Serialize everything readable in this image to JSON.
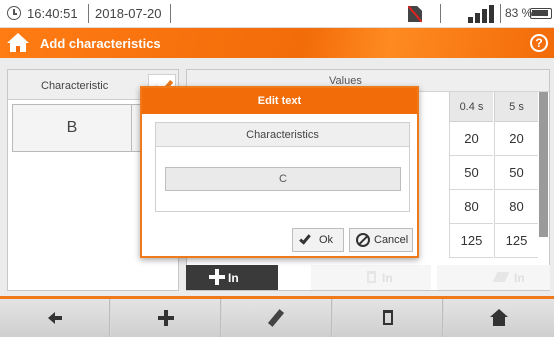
{
  "statusbar": {
    "time": "16:40:51",
    "date": "2018-07-20",
    "battery": "83 %"
  },
  "header": {
    "title": "Add characteristics"
  },
  "left_panel": {
    "header": "Characteristic",
    "items": [
      "B"
    ]
  },
  "right_panel": {
    "header": "Values",
    "columns": [
      "0.4 s",
      "5 s"
    ],
    "rows": [
      [
        "20",
        "20"
      ],
      [
        "50",
        "50"
      ],
      [
        "80",
        "80"
      ],
      [
        "125",
        "125"
      ]
    ]
  },
  "in_buttons": {
    "add_label": "In",
    "delete_label": "In",
    "clear_label": "In"
  },
  "dialog": {
    "title": "Edit text",
    "field_label": "Characteristics",
    "field_value": "C",
    "ok_label": "Ok",
    "cancel_label": "Cancel"
  },
  "colors": {
    "accent": "#f26c0a",
    "header_text": "#ffffff"
  },
  "toolbar_icons": [
    "back-icon",
    "add-icon",
    "pencil-icon",
    "trash-icon",
    "home-icon"
  ]
}
